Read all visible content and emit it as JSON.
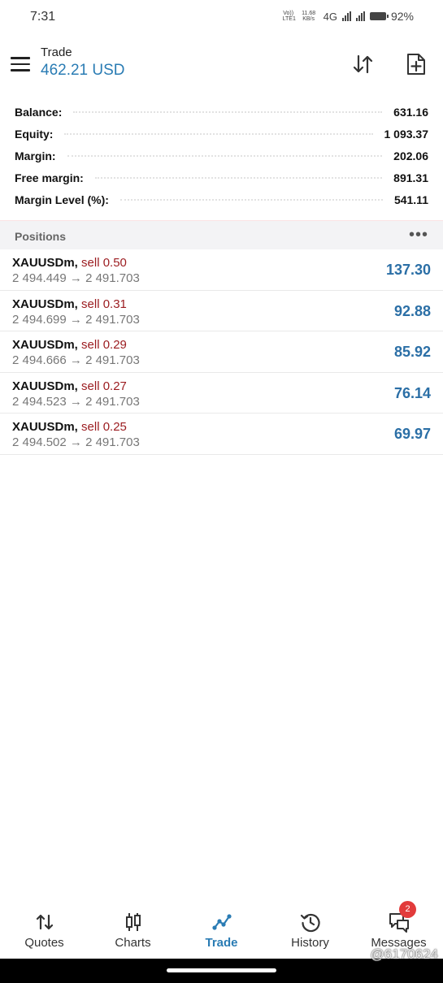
{
  "status_bar": {
    "time": "7:31",
    "volte": "Vo)) LTE1",
    "speed": "11.68 KB/s",
    "network": "4G",
    "battery": "92%"
  },
  "header": {
    "title": "Trade",
    "subtitle": "462.21 USD",
    "icons": [
      "menu-icon",
      "sort-icon",
      "new-order-icon"
    ]
  },
  "summary": [
    {
      "label": "Balance:",
      "value": "631.16"
    },
    {
      "label": "Equity:",
      "value": "1 093.37"
    },
    {
      "label": "Margin:",
      "value": "202.06"
    },
    {
      "label": "Free margin:",
      "value": "891.31"
    },
    {
      "label": "Margin Level (%):",
      "value": "541.11"
    }
  ],
  "positions_header": {
    "label": "Positions",
    "more": "•••"
  },
  "positions": [
    {
      "symbol": "XAUUSDm,",
      "direction": "sell 0.50",
      "prices": "2 494.449 → 2 491.703",
      "profit": "137.30"
    },
    {
      "symbol": "XAUUSDm,",
      "direction": "sell 0.31",
      "prices": "2 494.699 → 2 491.703",
      "profit": "92.88"
    },
    {
      "symbol": "XAUUSDm,",
      "direction": "sell 0.29",
      "prices": "2 494.666 → 2 491.703",
      "profit": "85.92"
    },
    {
      "symbol": "XAUUSDm,",
      "direction": "sell 0.27",
      "prices": "2 494.523 → 2 491.703",
      "profit": "76.14"
    },
    {
      "symbol": "XAUUSDm,",
      "direction": "sell 0.25",
      "prices": "2 494.502 → 2 491.703",
      "profit": "69.97"
    }
  ],
  "bottom_nav": [
    {
      "label": "Quotes",
      "icon": "quotes-icon"
    },
    {
      "label": "Charts",
      "icon": "charts-icon"
    },
    {
      "label": "Trade",
      "icon": "trade-icon",
      "active": true
    },
    {
      "label": "History",
      "icon": "history-icon"
    },
    {
      "label": "Messages",
      "icon": "messages-icon"
    }
  ],
  "messages_badge": "2",
  "watermark": "@6170624",
  "colors": {
    "accent": "#2a7cb4",
    "sell": "#9b1b1f",
    "profit": "#2b6fa6",
    "badge": "#e23b3b"
  }
}
